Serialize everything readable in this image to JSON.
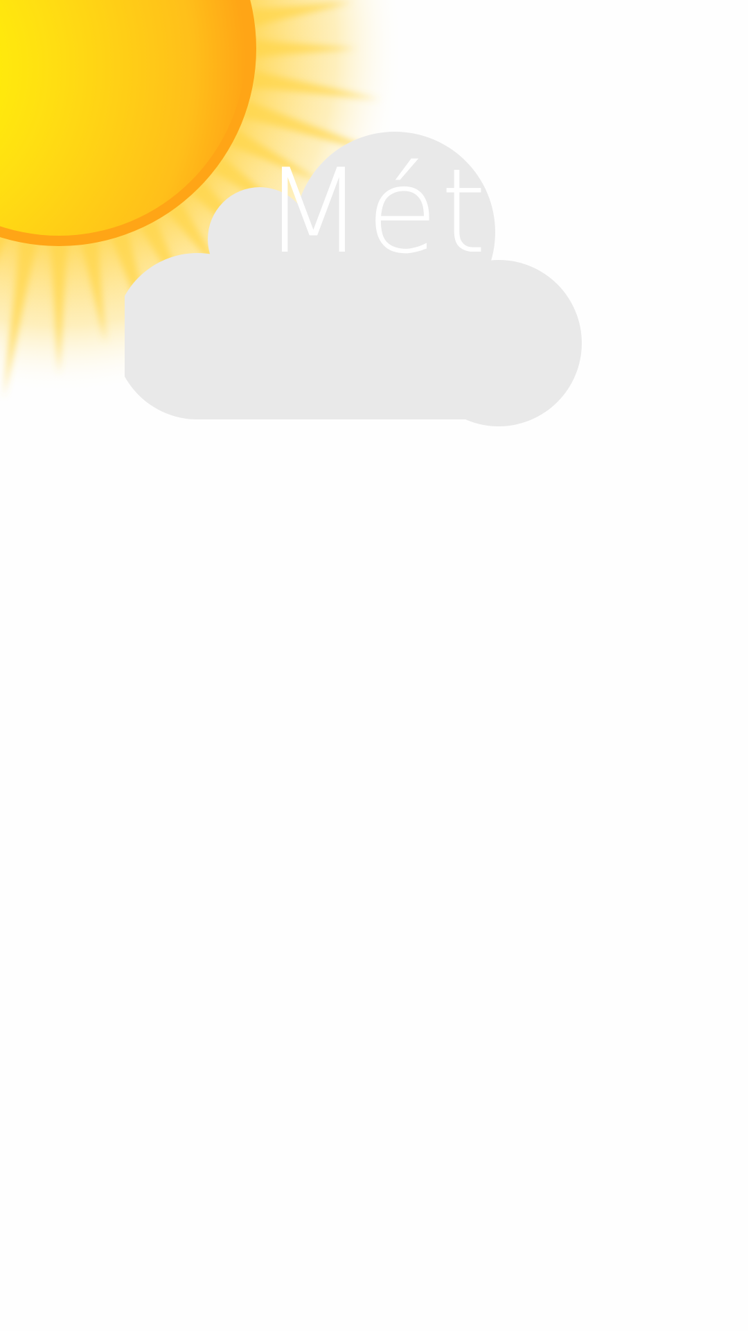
{
  "splash": {
    "title": "Mét",
    "sun_icon": "sun-icon",
    "cloud_icon": "cloud-icon"
  },
  "colors": {
    "background": "#fefefe",
    "sun_center": "#ffff00",
    "sun_mid": "#ffd21a",
    "sun_edge": "#ffa516",
    "sun_ray": "#ffd54a",
    "cloud": "#e9e9e9",
    "title": "#ffffff"
  }
}
